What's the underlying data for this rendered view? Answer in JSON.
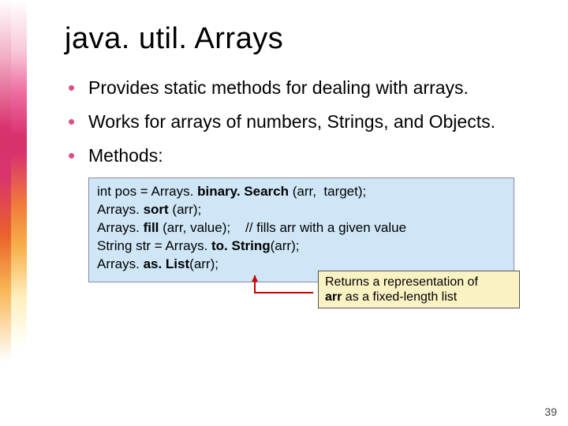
{
  "title": "java. util. Arrays",
  "bullets": [
    "Provides static methods for dealing with arrays.",
    "Works for arrays of numbers, Strings, and Objects.",
    "Methods:"
  ],
  "code": {
    "l1a": "int pos = Arrays. ",
    "l1b": "binary. Search",
    "l1c": " (arr,  target);",
    "l2a": "Arrays. ",
    "l2b": "sort",
    "l2c": " (arr);",
    "l3a": "Arrays. ",
    "l3b": "fill",
    "l3c": " (arr, value);    // fills arr with a given value",
    "l4a": "String str = Arrays. ",
    "l4b": "to. String",
    "l4c": "(arr);",
    "l5a": "Arrays. ",
    "l5b": "as. List",
    "l5c": "(arr);"
  },
  "callout": {
    "l1": "Returns a representation of",
    "l2a": "arr",
    "l2b": " as a fixed-length list"
  },
  "page_number": "39"
}
